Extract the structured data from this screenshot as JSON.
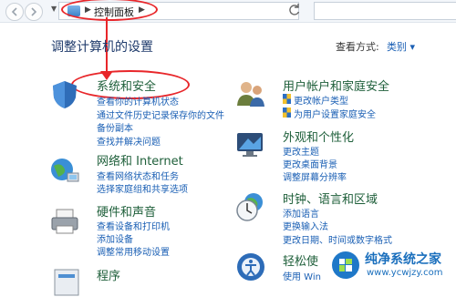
{
  "address_bar": {
    "crumb": "控制面板",
    "search_placeholder": ""
  },
  "header": {
    "title": "调整计算机的设置",
    "view_by_label": "查看方式:",
    "view_by_value": "类别"
  },
  "categories": [
    {
      "title": "系统和安全",
      "links": [
        "查看你的计算机状态",
        "通过文件历史记录保存你的文件",
        "备份副本",
        "查找并解决问题"
      ]
    },
    {
      "title": "网络和 Internet",
      "links": [
        "查看网络状态和任务",
        "选择家庭组和共享选项"
      ]
    },
    {
      "title": "硬件和声音",
      "links": [
        "查看设备和打印机",
        "添加设备",
        "调整常用移动设置"
      ]
    },
    {
      "title": "程序",
      "links": []
    },
    {
      "title": "用户帐户和家庭安全",
      "links": [
        "更改帐户类型",
        "为用户设置家庭安全"
      ]
    },
    {
      "title": "外观和个性化",
      "links": [
        "更改主题",
        "更改桌面背景",
        "调整屏幕分辨率"
      ]
    },
    {
      "title": "时钟、语言和区域",
      "links": [
        "添加语言",
        "更换输入法",
        "更改日期、时间或数字格式"
      ]
    },
    {
      "title": "轻松使",
      "links": [
        "使用 Win"
      ]
    }
  ],
  "watermark": {
    "title": "纯净系统之家",
    "url": "www.ycwjzy.com"
  },
  "colors": {
    "link": "#1a5fb4",
    "category_title": "#1e5f3a",
    "annotation": "#e8262a"
  }
}
